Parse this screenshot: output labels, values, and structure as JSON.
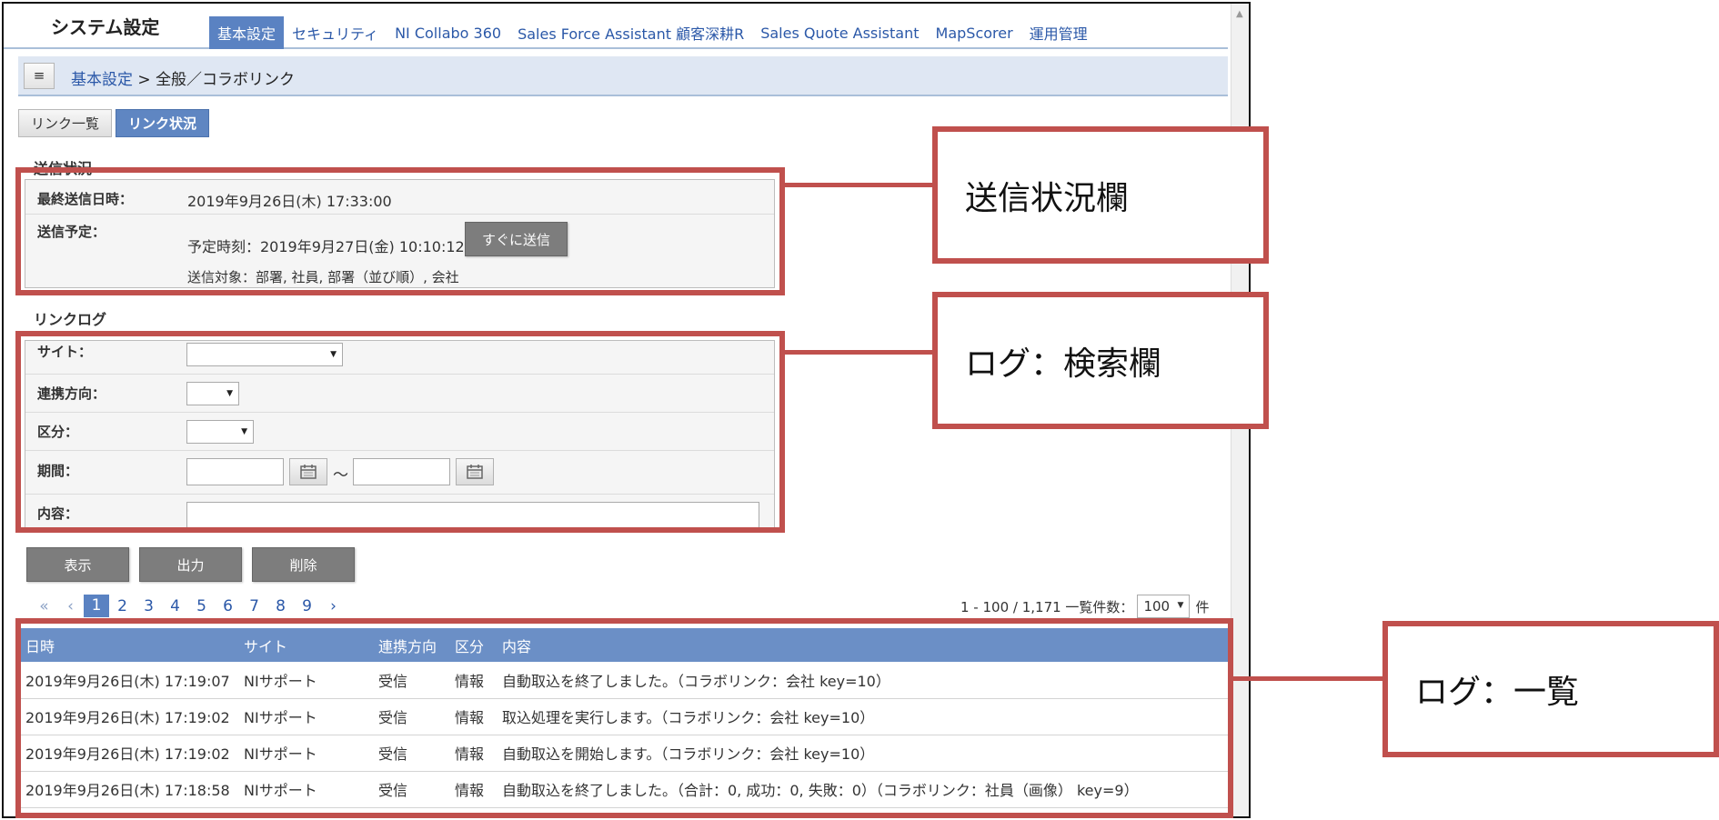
{
  "header": {
    "title": "システム設定",
    "tabs": [
      {
        "label": "基本設定",
        "active": true
      },
      {
        "label": "セキュリティ"
      },
      {
        "label": "NI Collabo 360"
      },
      {
        "label": "Sales Force Assistant 顧客深耕R"
      },
      {
        "label": "Sales Quote Assistant"
      },
      {
        "label": "MapScorer"
      },
      {
        "label": "運用管理"
      }
    ]
  },
  "breadcrumb": {
    "menu_icon": "≡",
    "link": "基本設定",
    "separator": " > ",
    "current": "全般／コラボリンク"
  },
  "sub_tabs": [
    {
      "label": "リンク一覧"
    },
    {
      "label": "リンク状況",
      "active": true
    }
  ],
  "send_status": {
    "section_title": "送信状況",
    "last_sent_label": "最終送信日時：",
    "last_sent_value": "2019年9月26日(木) 17:33:00",
    "schedule_label": "送信予定：",
    "schedule_time": "予定時刻：2019年9月27日(金) 10:10:12",
    "send_now_button": "すぐに送信",
    "targets": "送信対象：部署, 社員, 部署（並び順）, 会社"
  },
  "log_search": {
    "section_title": "リンクログ",
    "site_label": "サイト：",
    "direction_label": "連携方向：",
    "category_label": "区分：",
    "period_label": "期間：",
    "period_sep": "～",
    "content_label": "内容："
  },
  "actions": {
    "show": "表示",
    "export": "出力",
    "delete": "削除"
  },
  "pager": {
    "first": "«",
    "prev": "‹",
    "pages": [
      "1",
      "2",
      "3",
      "4",
      "5",
      "6",
      "7",
      "8",
      "9"
    ],
    "current_page": "1",
    "next": "›",
    "range": "1 - 100 / 1,171 一覧件数：",
    "per_page": "100",
    "unit": "件"
  },
  "log_table": {
    "columns": [
      "日時",
      "サイト",
      "連携方向",
      "区分",
      "内容"
    ],
    "rows": [
      [
        "2019年9月26日(木) 17:19:07",
        "NIサポート",
        "受信",
        "情報",
        "自動取込を終了しました。（コラボリンク：会社 key=10）"
      ],
      [
        "2019年9月26日(木) 17:19:02",
        "NIサポート",
        "受信",
        "情報",
        "取込処理を実行します。（コラボリンク：会社 key=10）"
      ],
      [
        "2019年9月26日(木) 17:19:02",
        "NIサポート",
        "受信",
        "情報",
        "自動取込を開始します。（コラボリンク：会社 key=10）"
      ],
      [
        "2019年9月26日(木) 17:18:58",
        "NIサポート",
        "受信",
        "情報",
        "自動取込を終了しました。（合計：0, 成功：0, 失敗：0）（コラボリンク：社員（画像） key=9）"
      ]
    ]
  },
  "callouts": {
    "send_status": "送信状況欄",
    "log_search": "ログ：検索欄",
    "log_list": "ログ：一覧"
  },
  "colors": {
    "annotation": "#c0504d",
    "accent": "#5a82c2",
    "table_header": "#6b8fc6"
  }
}
